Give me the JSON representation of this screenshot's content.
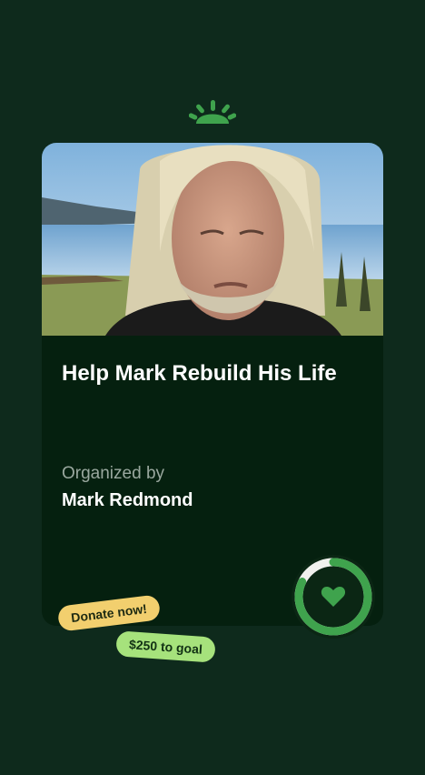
{
  "app": {
    "logo_icon": "gofundme-sprout-icon",
    "accent_color": "#3fa34d",
    "background_color": "#0e2a1c"
  },
  "fundraiser": {
    "photo": "organizer-selfie-photo",
    "title": "Help Mark Rebuild His Life",
    "organized_by_label": "Organized by",
    "organizer_name": "Mark Redmond",
    "progress_fraction": 0.82,
    "progress_icon": "heart-icon"
  },
  "badges": {
    "donate": "Donate now!",
    "goal": "$250 to goal"
  }
}
